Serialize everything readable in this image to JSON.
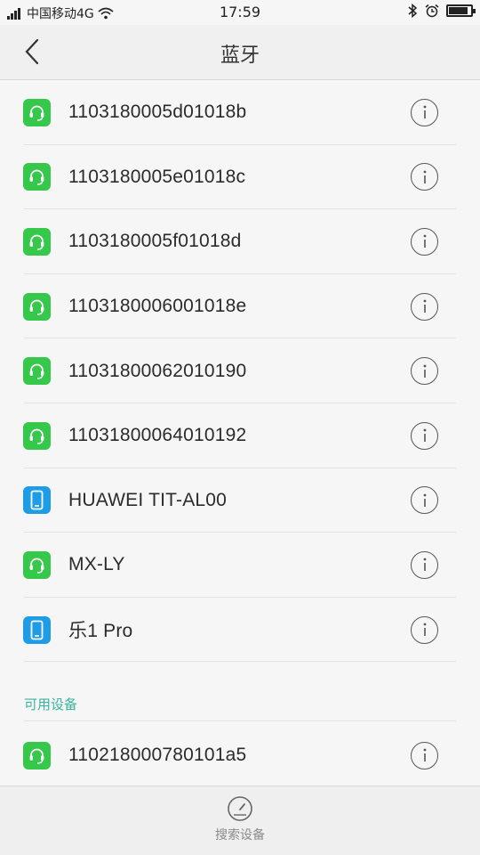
{
  "status_bar": {
    "carrier": "中国移动4G",
    "time": "17:59",
    "battery_level": 0.8
  },
  "header": {
    "title": "蓝牙"
  },
  "paired_devices": [
    {
      "name": "1103180005d01018b",
      "icon": "headset-icon"
    },
    {
      "name": "1103180005e01018c",
      "icon": "headset-icon"
    },
    {
      "name": "1103180005f01018d",
      "icon": "headset-icon"
    },
    {
      "name": "1103180006001018e",
      "icon": "headset-icon"
    },
    {
      "name": "11031800062010190",
      "icon": "headset-icon"
    },
    {
      "name": "11031800064010192",
      "icon": "headset-icon"
    },
    {
      "name": "HUAWEI TIT-AL00",
      "icon": "phone-icon"
    },
    {
      "name": "MX-LY",
      "icon": "headset-icon"
    },
    {
      "name": "乐1 Pro",
      "icon": "phone-icon"
    }
  ],
  "available_section": {
    "title": "可用设备",
    "devices": [
      {
        "name": "110218000780101a5",
        "icon": "headset-icon"
      }
    ]
  },
  "bottom_bar": {
    "search_label": "搜索设备"
  },
  "colors": {
    "headset_icon_bg": "#36c84b",
    "phone_icon_bg": "#1f9ce6",
    "section_header": "#3bb5a0"
  }
}
